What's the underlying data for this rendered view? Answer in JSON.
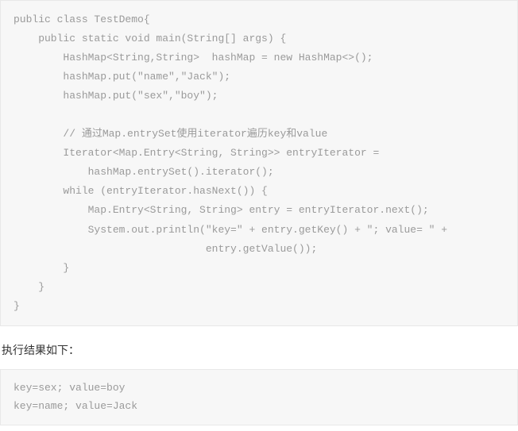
{
  "code": {
    "lines": [
      "public class TestDemo{",
      "    public static void main(String[] args) {",
      "        HashMap<String,String>  hashMap = new HashMap<>();",
      "        hashMap.put(\"name\",\"Jack\");",
      "        hashMap.put(\"sex\",\"boy\");",
      "",
      "        // 通过Map.entrySet使用iterator遍历key和value",
      "        Iterator<Map.Entry<String, String>> entryIterator = ",
      "            hashMap.entrySet().iterator();",
      "        while (entryIterator.hasNext()) {",
      "            Map.Entry<String, String> entry = entryIterator.next();",
      "            System.out.println(\"key=\" + entry.getKey() + \"; value= \" + ",
      "                               entry.getValue());",
      "        }",
      "    }",
      "}"
    ]
  },
  "section_label": "执行结果如下：",
  "output": {
    "lines": [
      "key=sex; value=boy",
      "key=name; value=Jack"
    ]
  }
}
